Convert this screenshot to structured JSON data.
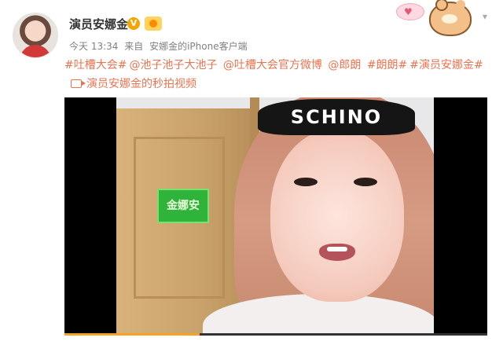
{
  "post": {
    "username": "演员安娜金",
    "verified_badge": "V",
    "meta": {
      "time": "今天 13:34",
      "source_prefix": "来自",
      "source": "安娜金的iPhone客户端"
    },
    "tags": [
      "#吐槽大会#",
      "@池子池子大池子",
      "@吐槽大会官方微博",
      "@郎朗",
      "#朗朗#",
      "#演员安娜金#"
    ],
    "video_link": "演员安娜金的秒拍视频",
    "video": {
      "headband_text": "SCHINO",
      "sign_text": "金娜安",
      "progress": 0.32
    }
  },
  "icons": [
    "camera-icon",
    "verified-icon",
    "member-icon",
    "chevron-down-icon"
  ],
  "colors": {
    "accent": "#eb7350",
    "verified": "#f7a400",
    "progress": "#f6a229",
    "text": "#333333",
    "meta": "#808080"
  }
}
